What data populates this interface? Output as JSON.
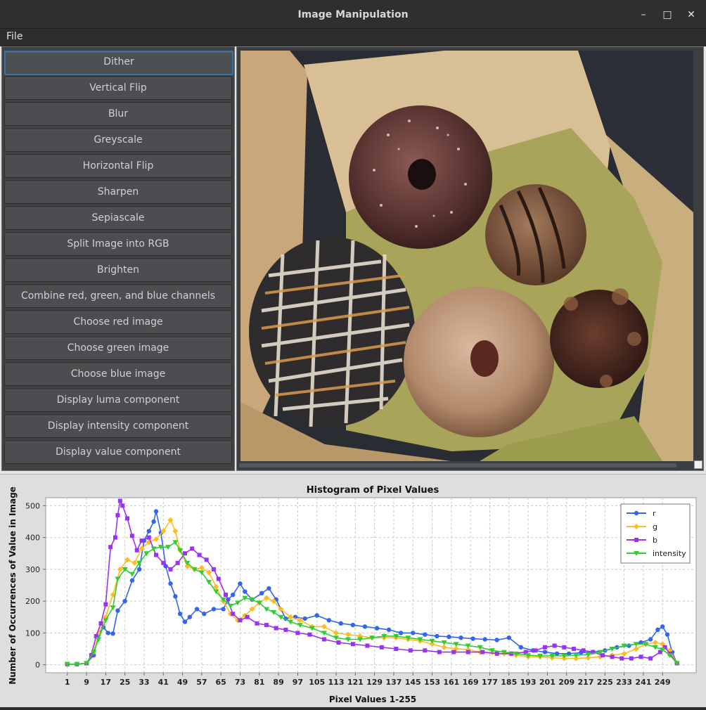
{
  "window": {
    "title": "Image Manipulation",
    "minimize_label": "–",
    "maximize_label": "□",
    "close_label": "✕"
  },
  "menu": {
    "file": "File"
  },
  "operations": [
    "Dither",
    "Vertical Flip",
    "Blur",
    "Greyscale",
    "Horizontal Flip",
    "Sharpen",
    "Sepiascale",
    "Split Image into RGB",
    "Brighten",
    "Combine red, green, and blue channels",
    "Choose red image",
    "Choose green image",
    "Choose blue image",
    "Display luma component",
    "Display intensity component",
    "Display value component"
  ],
  "chart_data": {
    "type": "line",
    "title": "Histogram of Pixel Values",
    "xlabel": "Pixel Values 1-255",
    "ylabel": "Number of Occurrences of Value in Image",
    "xlim": [
      -8,
      263
    ],
    "ylim": [
      -25,
      525
    ],
    "x_ticks": [
      1,
      9,
      17,
      25,
      33,
      41,
      49,
      57,
      65,
      73,
      81,
      89,
      97,
      105,
      113,
      121,
      129,
      137,
      145,
      153,
      161,
      169,
      177,
      185,
      193,
      201,
      209,
      217,
      225,
      233,
      241,
      249
    ],
    "y_ticks": [
      0,
      100,
      200,
      300,
      400,
      500
    ],
    "grid": true,
    "legend_position": "top-right",
    "series": [
      {
        "name": "r",
        "color": "#3366ee",
        "marker": "circle",
        "points": [
          [
            1,
            2
          ],
          [
            5,
            2
          ],
          [
            9,
            5
          ],
          [
            12,
            30
          ],
          [
            14,
            95
          ],
          [
            16,
            118
          ],
          [
            18,
            100
          ],
          [
            20,
            98
          ],
          [
            22,
            170
          ],
          [
            25,
            200
          ],
          [
            28,
            265
          ],
          [
            31,
            300
          ],
          [
            33,
            390
          ],
          [
            35,
            420
          ],
          [
            37,
            450
          ],
          [
            38,
            482
          ],
          [
            40,
            415
          ],
          [
            42,
            310
          ],
          [
            44,
            255
          ],
          [
            46,
            215
          ],
          [
            48,
            160
          ],
          [
            50,
            135
          ],
          [
            52,
            150
          ],
          [
            55,
            175
          ],
          [
            58,
            160
          ],
          [
            62,
            175
          ],
          [
            66,
            175
          ],
          [
            68,
            205
          ],
          [
            70,
            220
          ],
          [
            73,
            255
          ],
          [
            75,
            230
          ],
          [
            78,
            205
          ],
          [
            82,
            225
          ],
          [
            85,
            240
          ],
          [
            88,
            205
          ],
          [
            92,
            145
          ],
          [
            96,
            150
          ],
          [
            100,
            145
          ],
          [
            105,
            155
          ],
          [
            110,
            140
          ],
          [
            115,
            130
          ],
          [
            120,
            125
          ],
          [
            125,
            120
          ],
          [
            130,
            115
          ],
          [
            135,
            110
          ],
          [
            140,
            100
          ],
          [
            145,
            100
          ],
          [
            150,
            95
          ],
          [
            155,
            90
          ],
          [
            160,
            88
          ],
          [
            165,
            85
          ],
          [
            170,
            82
          ],
          [
            175,
            80
          ],
          [
            180,
            78
          ],
          [
            185,
            85
          ],
          [
            190,
            55
          ],
          [
            195,
            45
          ],
          [
            200,
            40
          ],
          [
            205,
            35
          ],
          [
            210,
            35
          ],
          [
            215,
            38
          ],
          [
            220,
            40
          ],
          [
            225,
            45
          ],
          [
            230,
            55
          ],
          [
            235,
            60
          ],
          [
            240,
            70
          ],
          [
            244,
            80
          ],
          [
            247,
            110
          ],
          [
            249,
            120
          ],
          [
            251,
            95
          ],
          [
            253,
            40
          ],
          [
            255,
            5
          ]
        ]
      },
      {
        "name": "g",
        "color": "#ffbb22",
        "marker": "diamond",
        "points": [
          [
            1,
            2
          ],
          [
            5,
            2
          ],
          [
            9,
            5
          ],
          [
            12,
            40
          ],
          [
            14,
            100
          ],
          [
            17,
            150
          ],
          [
            20,
            220
          ],
          [
            23,
            300
          ],
          [
            26,
            330
          ],
          [
            29,
            320
          ],
          [
            32,
            365
          ],
          [
            35,
            385
          ],
          [
            38,
            395
          ],
          [
            41,
            420
          ],
          [
            44,
            455
          ],
          [
            46,
            420
          ],
          [
            48,
            360
          ],
          [
            51,
            310
          ],
          [
            54,
            300
          ],
          [
            57,
            305
          ],
          [
            60,
            290
          ],
          [
            63,
            245
          ],
          [
            66,
            200
          ],
          [
            69,
            160
          ],
          [
            72,
            140
          ],
          [
            75,
            155
          ],
          [
            78,
            175
          ],
          [
            81,
            195
          ],
          [
            84,
            210
          ],
          [
            87,
            200
          ],
          [
            90,
            175
          ],
          [
            94,
            150
          ],
          [
            98,
            140
          ],
          [
            103,
            120
          ],
          [
            108,
            120
          ],
          [
            113,
            100
          ],
          [
            118,
            95
          ],
          [
            123,
            90
          ],
          [
            128,
            85
          ],
          [
            133,
            85
          ],
          [
            138,
            85
          ],
          [
            143,
            80
          ],
          [
            148,
            75
          ],
          [
            153,
            65
          ],
          [
            158,
            55
          ],
          [
            163,
            50
          ],
          [
            168,
            48
          ],
          [
            173,
            40
          ],
          [
            178,
            38
          ],
          [
            183,
            35
          ],
          [
            188,
            30
          ],
          [
            193,
            25
          ],
          [
            198,
            25
          ],
          [
            203,
            22
          ],
          [
            208,
            20
          ],
          [
            213,
            20
          ],
          [
            218,
            22
          ],
          [
            223,
            25
          ],
          [
            228,
            30
          ],
          [
            233,
            35
          ],
          [
            238,
            50
          ],
          [
            242,
            65
          ],
          [
            246,
            70
          ],
          [
            249,
            65
          ],
          [
            252,
            45
          ],
          [
            255,
            5
          ]
        ]
      },
      {
        "name": "b",
        "color": "#9933ee",
        "marker": "square",
        "points": [
          [
            1,
            2
          ],
          [
            5,
            2
          ],
          [
            9,
            5
          ],
          [
            11,
            30
          ],
          [
            13,
            90
          ],
          [
            15,
            130
          ],
          [
            17,
            190
          ],
          [
            19,
            370
          ],
          [
            21,
            400
          ],
          [
            22,
            470
          ],
          [
            23,
            515
          ],
          [
            24,
            500
          ],
          [
            26,
            460
          ],
          [
            28,
            405
          ],
          [
            30,
            360
          ],
          [
            32,
            390
          ],
          [
            35,
            400
          ],
          [
            38,
            345
          ],
          [
            41,
            320
          ],
          [
            44,
            300
          ],
          [
            47,
            320
          ],
          [
            50,
            350
          ],
          [
            53,
            365
          ],
          [
            56,
            345
          ],
          [
            59,
            330
          ],
          [
            62,
            300
          ],
          [
            64,
            270
          ],
          [
            67,
            220
          ],
          [
            70,
            160
          ],
          [
            73,
            140
          ],
          [
            76,
            150
          ],
          [
            80,
            130
          ],
          [
            84,
            125
          ],
          [
            88,
            115
          ],
          [
            92,
            110
          ],
          [
            97,
            100
          ],
          [
            102,
            95
          ],
          [
            108,
            80
          ],
          [
            114,
            70
          ],
          [
            120,
            65
          ],
          [
            126,
            60
          ],
          [
            132,
            55
          ],
          [
            138,
            50
          ],
          [
            144,
            45
          ],
          [
            150,
            45
          ],
          [
            156,
            40
          ],
          [
            162,
            40
          ],
          [
            168,
            40
          ],
          [
            174,
            40
          ],
          [
            180,
            35
          ],
          [
            186,
            35
          ],
          [
            192,
            40
          ],
          [
            196,
            45
          ],
          [
            200,
            55
          ],
          [
            204,
            60
          ],
          [
            208,
            55
          ],
          [
            212,
            50
          ],
          [
            216,
            45
          ],
          [
            220,
            40
          ],
          [
            224,
            30
          ],
          [
            228,
            25
          ],
          [
            232,
            20
          ],
          [
            236,
            20
          ],
          [
            240,
            25
          ],
          [
            244,
            20
          ],
          [
            248,
            40
          ],
          [
            250,
            55
          ],
          [
            252,
            35
          ],
          [
            255,
            5
          ]
        ]
      },
      {
        "name": "intensity",
        "color": "#33cc33",
        "marker": "triangle-down",
        "points": [
          [
            1,
            2
          ],
          [
            5,
            2
          ],
          [
            9,
            5
          ],
          [
            12,
            40
          ],
          [
            14,
            80
          ],
          [
            17,
            140
          ],
          [
            20,
            180
          ],
          [
            22,
            270
          ],
          [
            25,
            300
          ],
          [
            28,
            285
          ],
          [
            31,
            320
          ],
          [
            34,
            350
          ],
          [
            37,
            365
          ],
          [
            40,
            370
          ],
          [
            43,
            370
          ],
          [
            46,
            385
          ],
          [
            48,
            360
          ],
          [
            51,
            320
          ],
          [
            54,
            300
          ],
          [
            57,
            290
          ],
          [
            60,
            260
          ],
          [
            63,
            230
          ],
          [
            66,
            205
          ],
          [
            69,
            185
          ],
          [
            72,
            195
          ],
          [
            75,
            210
          ],
          [
            78,
            205
          ],
          [
            81,
            195
          ],
          [
            84,
            175
          ],
          [
            87,
            165
          ],
          [
            90,
            150
          ],
          [
            94,
            135
          ],
          [
            98,
            125
          ],
          [
            103,
            115
          ],
          [
            108,
            100
          ],
          [
            113,
            85
          ],
          [
            118,
            80
          ],
          [
            123,
            80
          ],
          [
            128,
            85
          ],
          [
            133,
            90
          ],
          [
            138,
            90
          ],
          [
            143,
            85
          ],
          [
            148,
            80
          ],
          [
            153,
            75
          ],
          [
            158,
            70
          ],
          [
            163,
            65
          ],
          [
            168,
            60
          ],
          [
            173,
            55
          ],
          [
            178,
            45
          ],
          [
            183,
            40
          ],
          [
            188,
            35
          ],
          [
            193,
            30
          ],
          [
            198,
            28
          ],
          [
            203,
            28
          ],
          [
            208,
            28
          ],
          [
            213,
            30
          ],
          [
            218,
            32
          ],
          [
            223,
            40
          ],
          [
            228,
            50
          ],
          [
            233,
            60
          ],
          [
            238,
            65
          ],
          [
            242,
            65
          ],
          [
            246,
            55
          ],
          [
            249,
            48
          ],
          [
            252,
            30
          ],
          [
            255,
            5
          ]
        ]
      }
    ]
  }
}
